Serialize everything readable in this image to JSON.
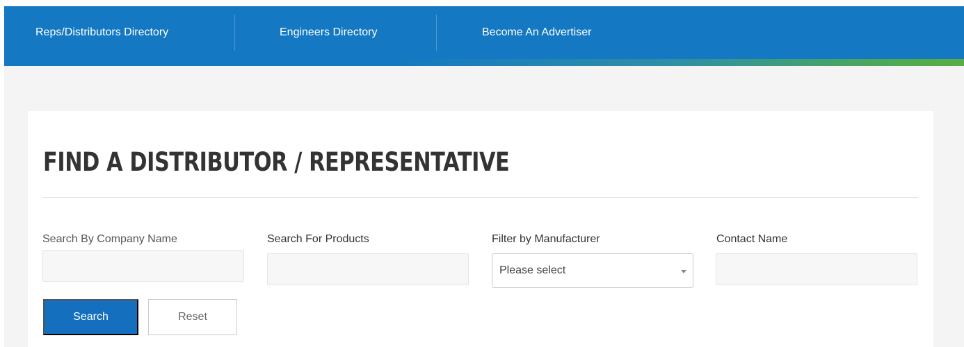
{
  "nav": {
    "items": [
      {
        "label": "Reps/Distributors Directory"
      },
      {
        "label": "Engineers Directory"
      },
      {
        "label": "Become An Advertiser"
      }
    ]
  },
  "main": {
    "title": "FIND A DISTRIBUTOR / REPRESENTATIVE",
    "fields": {
      "company": {
        "label": "Search By Company Name",
        "value": ""
      },
      "products": {
        "label": "Search For Products",
        "value": ""
      },
      "manufacturer": {
        "label": "Filter by Manufacturer",
        "selected": "Please select"
      },
      "contact": {
        "label": "Contact Name",
        "value": ""
      }
    },
    "buttons": {
      "search": "Search",
      "reset": "Reset"
    }
  },
  "colors": {
    "nav_bg": "#1478c2",
    "nav_accent_green": "#59ad43",
    "primary_button": "#1470bf",
    "page_bg": "#f4f4f4"
  },
  "icons": {
    "select_caret": "caret-down-icon"
  }
}
